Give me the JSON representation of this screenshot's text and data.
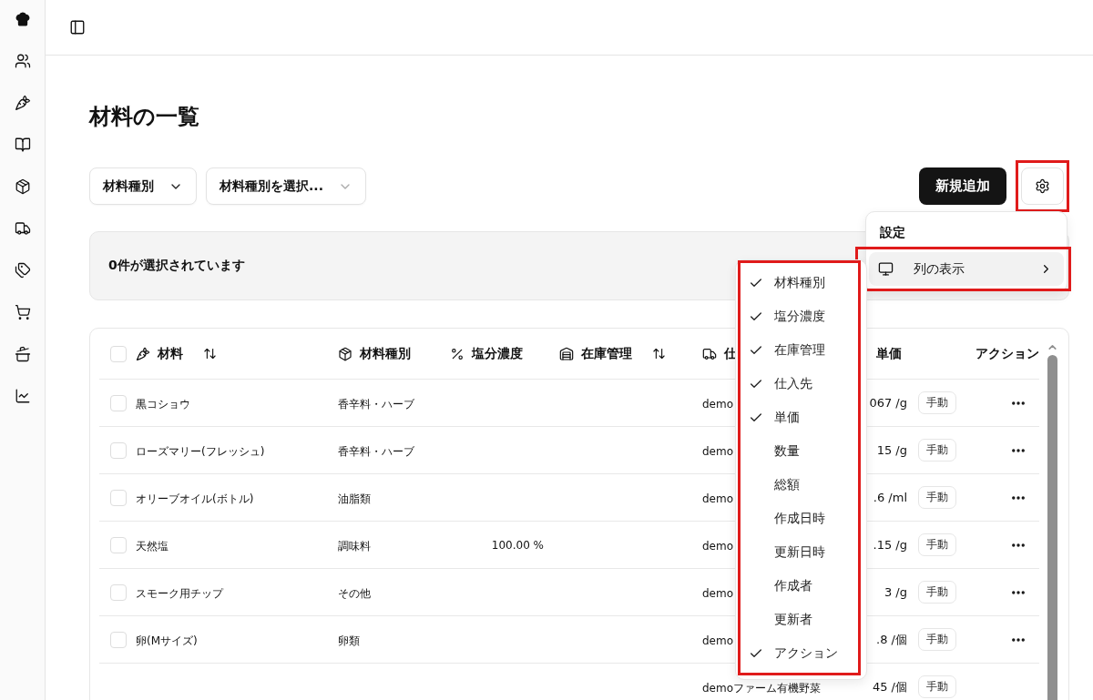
{
  "page": {
    "title": "材料の一覧"
  },
  "filters": [
    {
      "label": "材料種別",
      "muted_caret": false
    },
    {
      "label": "材料種別を選択...",
      "muted_caret": true
    }
  ],
  "add_button": "新規追加",
  "settings_button": {
    "highlighted": true
  },
  "selection_bar": "0件が選択されています",
  "table": {
    "header_checked": false,
    "columns": [
      {
        "label": "材料",
        "sortable": true
      },
      {
        "label": "材料種別",
        "sortable": false
      },
      {
        "label": "塩分濃度",
        "sortable": false
      },
      {
        "label": "在庫管理",
        "sortable": true
      },
      {
        "label": "仕"
      },
      {
        "label": "単価",
        "sortable": false
      },
      {
        "label": "アクション",
        "sortable": false
      }
    ],
    "rows": [
      {
        "checked": false,
        "name": "黒コショウ",
        "type": "香辛料・ハーブ",
        "supplier": "demo",
        "price": "067 /g",
        "source": "手動",
        "actions": true
      },
      {
        "checked": false,
        "name": "ローズマリー(フレッシュ)",
        "type": "香辛料・ハーブ",
        "supplier": "demo",
        "price": "15 /g",
        "source": "手動",
        "actions": true
      },
      {
        "checked": false,
        "name": "オリーブオイル(ボトル)",
        "type": "油脂類",
        "supplier": "demo",
        "price": ".6 /ml",
        "source": "手動",
        "actions": true
      },
      {
        "checked": false,
        "name": "天然塩",
        "type": "調味料",
        "salt": "100.00 %",
        "supplier": "demo",
        "price": ".15 /g",
        "source": "手動",
        "actions": true
      },
      {
        "checked": false,
        "name": "スモーク用チップ",
        "type": "その他",
        "supplier": "demo",
        "price": "3 /g",
        "source": "手動",
        "actions": true
      },
      {
        "checked": false,
        "name": "卵(Mサイズ)",
        "type": "卵類",
        "supplier": "demo",
        "price": ".8 /個",
        "source": "手動",
        "actions": true
      },
      {
        "supplier": "demoファーム有機野菜",
        "price": "45 /個",
        "source": "手動",
        "actions": false
      }
    ]
  },
  "settings_menu": {
    "title": "設定",
    "items": [
      {
        "label": "列の表示",
        "selected": true,
        "highlighted": true
      }
    ]
  },
  "columns_submenu": {
    "highlighted": true,
    "items": [
      {
        "label": "材料種別",
        "checked": true
      },
      {
        "label": "塩分濃度",
        "checked": true
      },
      {
        "label": "在庫管理",
        "checked": true
      },
      {
        "label": "仕入先",
        "checked": true
      },
      {
        "label": "単価",
        "checked": true
      },
      {
        "label": "数量",
        "checked": false
      },
      {
        "label": "総額",
        "checked": false
      },
      {
        "label": "作成日時",
        "checked": false
      },
      {
        "label": "更新日時",
        "checked": false
      },
      {
        "label": "作成者",
        "checked": false
      },
      {
        "label": "更新者",
        "checked": false
      },
      {
        "label": "アクション",
        "checked": true
      }
    ]
  }
}
